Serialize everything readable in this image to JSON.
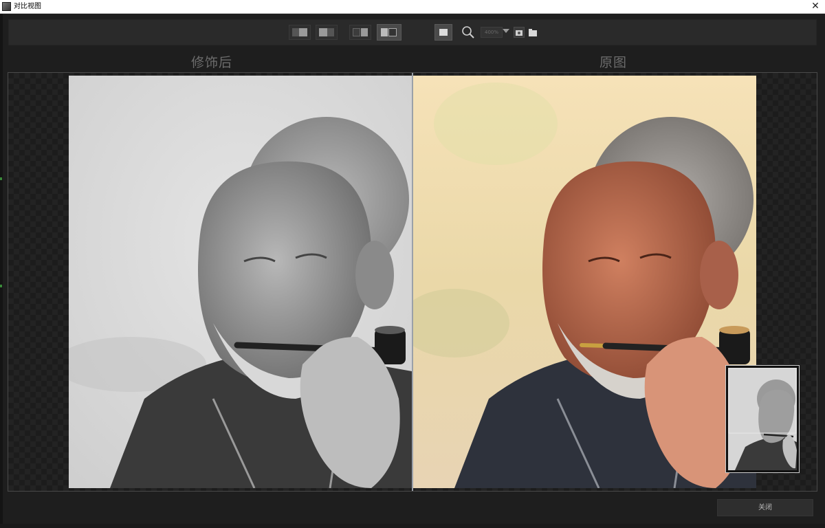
{
  "window": {
    "title": "对比视图",
    "close_symbol": "✕"
  },
  "toolbar": {
    "buttons": [
      {
        "name": "layout-single-left-icon"
      },
      {
        "name": "layout-single-right-icon"
      },
      {
        "name": "layout-split-vertical-icon"
      },
      {
        "name": "layout-side-by-side-icon",
        "active": true
      },
      {
        "name": "fit-view-icon"
      }
    ],
    "zoom_icon": "magnifier-icon",
    "zoom_value": "400%",
    "extra_icons": [
      "image-icon",
      "folder-icon"
    ]
  },
  "labels": {
    "after": "修饰后",
    "before": "原图"
  },
  "footer": {
    "close_label": "关闭"
  },
  "colors": {
    "background": "#1e1e1e",
    "toolbar": "#2a2a2a",
    "label": "#6c6c6c",
    "divider": "#9aa0a8"
  }
}
